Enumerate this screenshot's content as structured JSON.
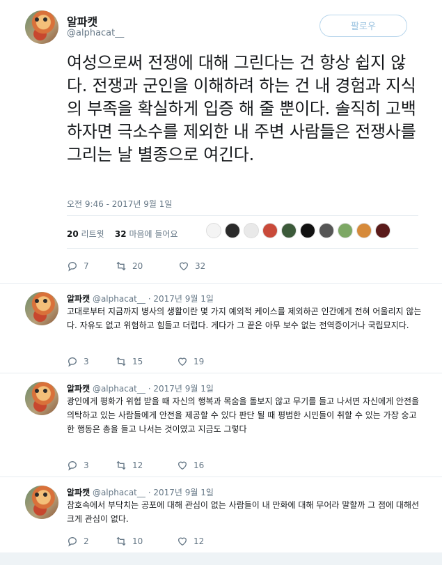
{
  "main": {
    "name": "알파캣",
    "handle": "@alphacat__",
    "follow_label": "팔로우",
    "text": "여성으로써 전쟁에 대해 그린다는 건 항상 쉽지 않다. 전쟁과 군인을 이해하려 하는 건 내 경험과 지식의 부족을 확실하게 입증 해 줄 뿐이다. 솔직히 고백하자면 극소수를 제외한 내 주변 사람들은 전쟁사를 그리는 날 별종으로 여긴다.",
    "timestamp": "오전 9:46 - 2017년 9월 1일",
    "retweets_count": "20",
    "retweets_label": "리트윗",
    "likes_count": "32",
    "likes_label": "마음에 들어요",
    "actions": {
      "reply": "7",
      "retweet": "20",
      "like": "32"
    }
  },
  "replies": [
    {
      "name": "알파캣",
      "handle": "@alphacat__",
      "date": "· 2017년 9월 1일",
      "text": "고대로부터 지금까지 병사의 생활이란 몇 가지 예외적 케이스를 제외하곤 인간에게 전혀 어울리지 않는다. 자유도 없고 위험하고 힘들고 더럽다. 게다가 그 끝은 아무 보수 없는 전역증이거나 국립묘지다.",
      "reply": "3",
      "retweet": "15",
      "like": "19"
    },
    {
      "name": "알파캣",
      "handle": "@alphacat__",
      "date": "· 2017년 9월 1일",
      "text": "광인에게 평화가 위협 받을 때 자신의 행복과 목숨을 돌보지 않고 무기를 들고 나서면 자신에게 안전을 의탁하고 있는 사람들에게 안전을 제공할 수 있다 판단 될 때 평범한 시민들이 취할 수 있는 가장 숭고한 행동은 총을 들고 나서는 것이였고 지금도 그렇다",
      "reply": "3",
      "retweet": "12",
      "like": "16"
    },
    {
      "name": "알파캣",
      "handle": "@alphacat__",
      "date": "· 2017년 9월 1일",
      "text": "참호속에서 부닥치는 공포에 대해 관심이 없는 사람들이 내 만화에 대해 무어라 말할까 그 점에 대해선 크게 관심이 없다.",
      "reply": "2",
      "retweet": "10",
      "like": "12"
    }
  ],
  "icons": [
    "reply-icon",
    "retweet-icon",
    "like-icon"
  ],
  "colors": {
    "accent": "#1da1f2",
    "muted": "#657786",
    "border": "#e6ecf0"
  }
}
